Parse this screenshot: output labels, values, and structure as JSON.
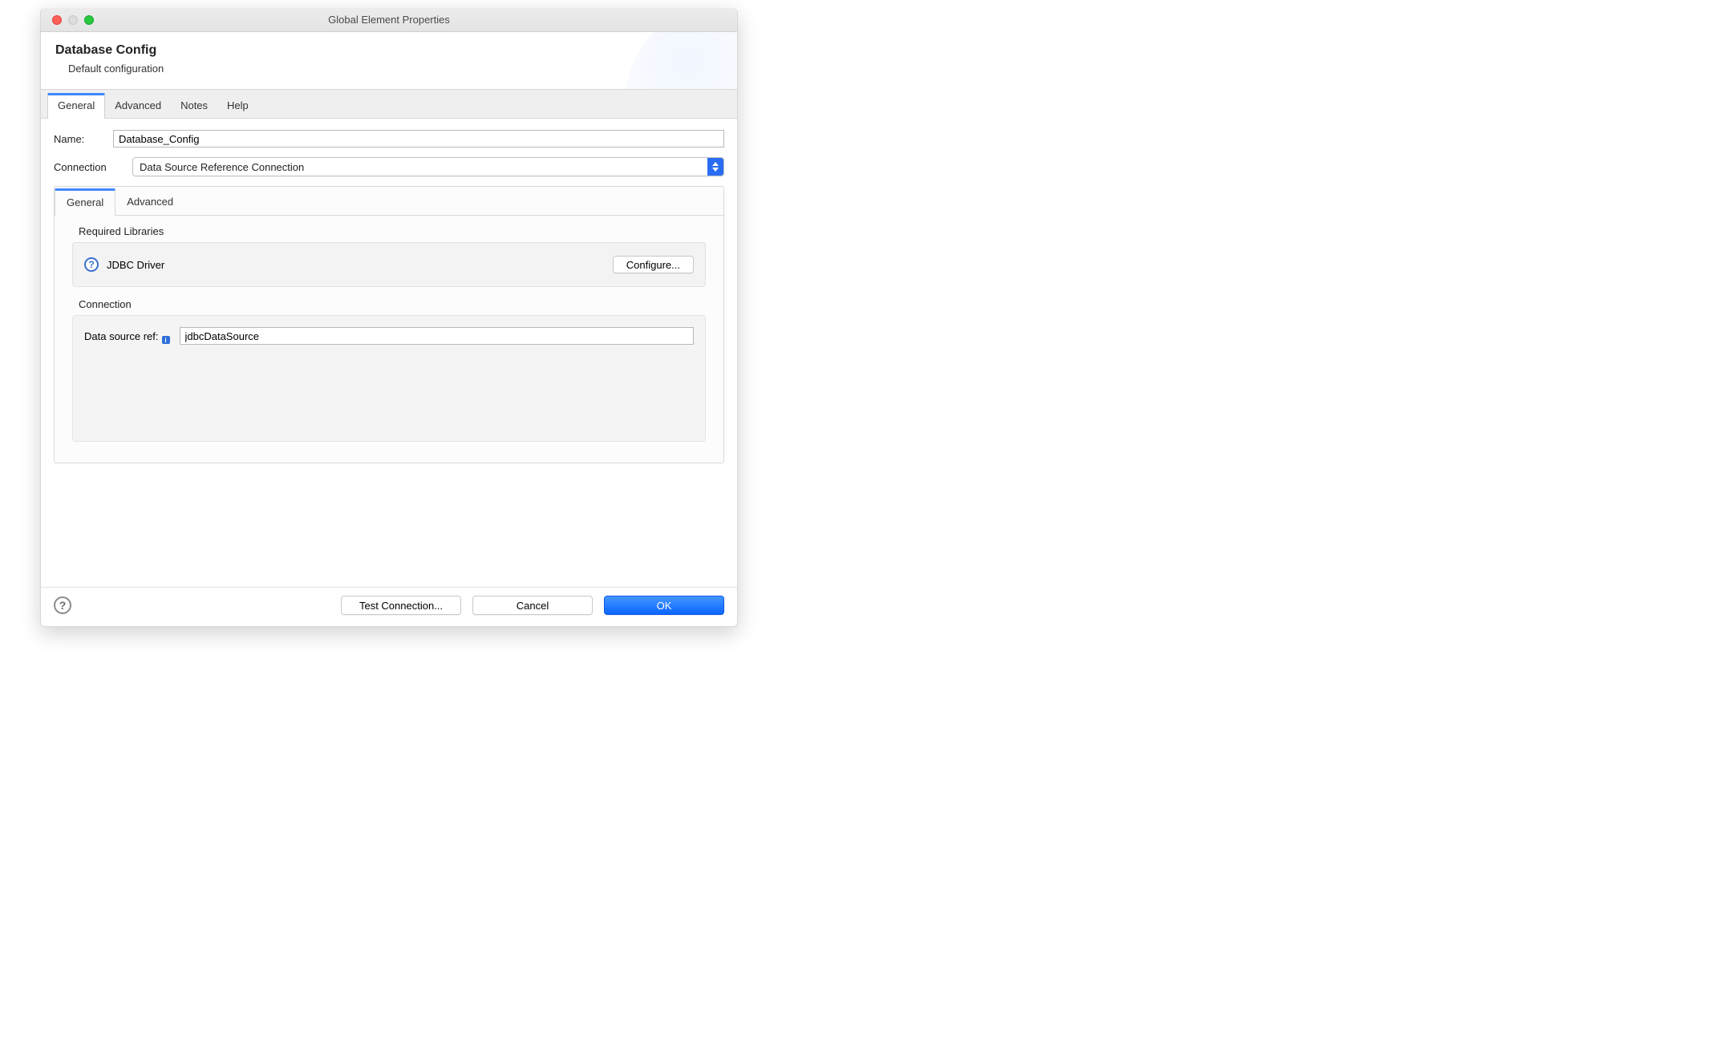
{
  "window": {
    "title": "Global Element Properties"
  },
  "header": {
    "title": "Database Config",
    "subtitle": "Default configuration"
  },
  "tabs": [
    {
      "label": "General"
    },
    {
      "label": "Advanced"
    },
    {
      "label": "Notes"
    },
    {
      "label": "Help"
    }
  ],
  "form": {
    "name_label": "Name:",
    "name_value": "Database_Config",
    "connection_label": "Connection",
    "connection_value": "Data Source Reference Connection"
  },
  "inner_tabs": [
    {
      "label": "General"
    },
    {
      "label": "Advanced"
    }
  ],
  "required_libraries": {
    "section_label": "Required Libraries",
    "driver_label": "JDBC Driver",
    "configure_label": "Configure..."
  },
  "connection_section": {
    "section_label": "Connection",
    "ds_label": "Data source ref:",
    "ds_value": "jdbcDataSource"
  },
  "footer": {
    "test_label": "Test Connection...",
    "cancel_label": "Cancel",
    "ok_label": "OK"
  }
}
